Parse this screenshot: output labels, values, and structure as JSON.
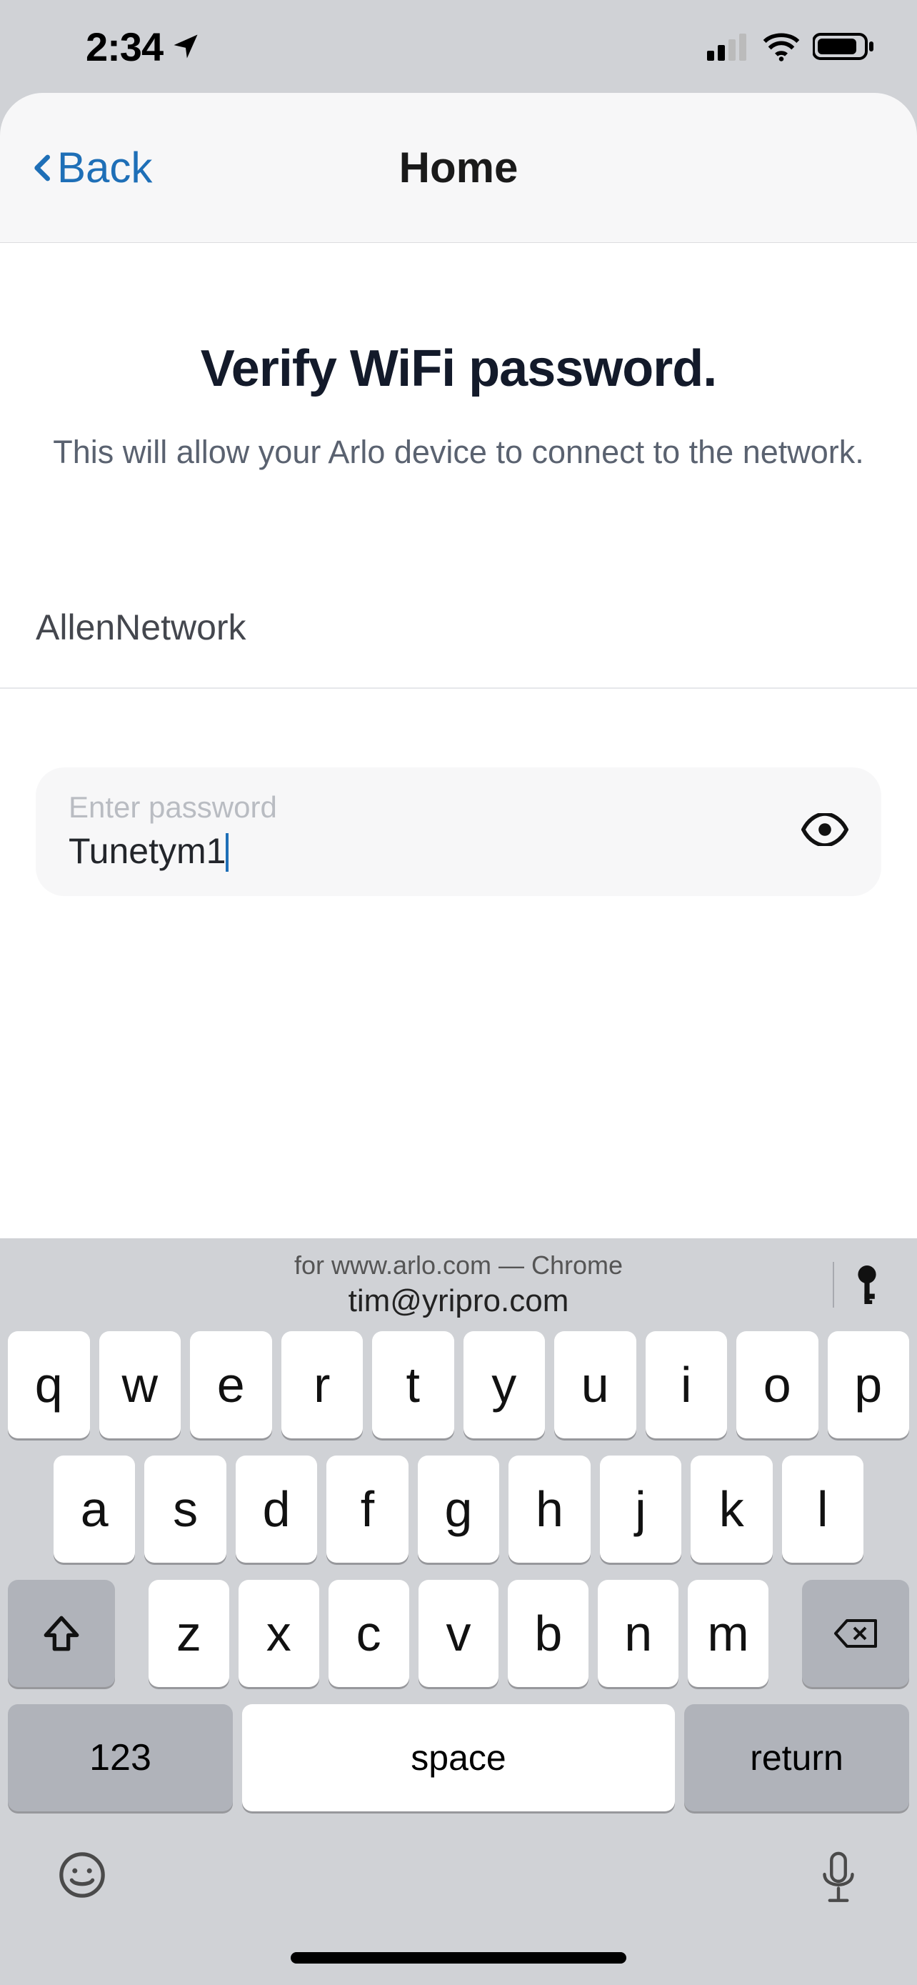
{
  "status": {
    "time": "2:34",
    "signal_bars": 2,
    "wifi": true,
    "battery": 80
  },
  "nav": {
    "back_label": "Back",
    "title": "Home"
  },
  "page": {
    "headline": "Verify WiFi password.",
    "subhead": "This will allow your Arlo device to connect to the network.",
    "network_name": "AllenNetwork",
    "password_placeholder": "Enter password",
    "password_value": "Tunetym1"
  },
  "keyboard": {
    "autofill_line1": "for www.arlo.com — Chrome",
    "autofill_line2": "tim@yripro.com",
    "rows": [
      [
        "q",
        "w",
        "e",
        "r",
        "t",
        "y",
        "u",
        "i",
        "o",
        "p"
      ],
      [
        "a",
        "s",
        "d",
        "f",
        "g",
        "h",
        "j",
        "k",
        "l"
      ],
      [
        "z",
        "x",
        "c",
        "v",
        "b",
        "n",
        "m"
      ]
    ],
    "key_123": "123",
    "key_space": "space",
    "key_return": "return"
  }
}
